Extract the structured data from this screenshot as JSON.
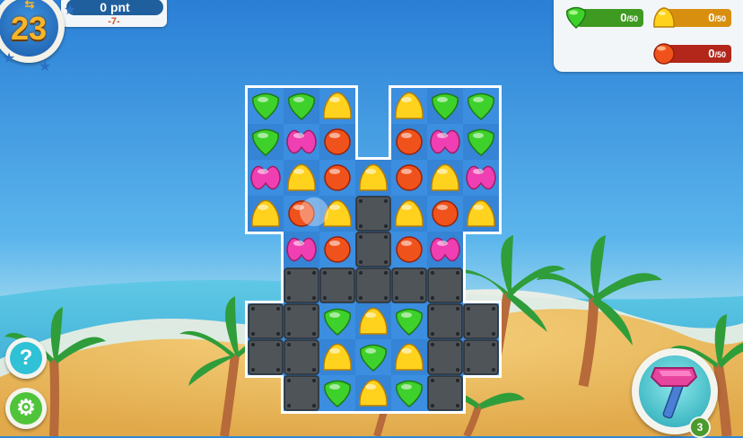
{
  "hud": {
    "moves": "23",
    "score": "0 pnt",
    "target": "-7-"
  },
  "goals": [
    {
      "current": "0",
      "total": "/50",
      "icon": "green-candy-icon",
      "color": "#3f9a22"
    },
    {
      "current": "0",
      "total": "/50",
      "icon": "yellow-candy-icon",
      "color": "#d88f10"
    },
    {
      "current": "0",
      "total": "/50",
      "icon": "red-candy-icon",
      "color": "#b3261a"
    }
  ],
  "boosters": {
    "hammer": {
      "count": "3",
      "icon": "hammer-icon"
    },
    "help_icon": "question-icon",
    "settings_icon": "gear-icon"
  },
  "board": {
    "candy_colors": {
      "green": "#3ed12b",
      "yellow": "#ffd21e",
      "red": "#f0521b",
      "pink": "#f03fb2"
    },
    "rows": [
      "GGY.YGG",
      "GPR.RPG",
      "PYRYRYP",
      "YRYBYRY",
      ".PRBRP.",
      ".BBBBB.",
      "BBGYGBB",
      "BBYGYBB",
      ".BGYGB."
    ],
    "selected_cell": {
      "row": 3,
      "col": 1
    }
  },
  "colors": {
    "board_tile": "#3b8ee0",
    "board_border": "#ffffff",
    "blocker": "#4f5458",
    "help_button": "#2fc1d6",
    "settings_button": "#4fc33a"
  }
}
